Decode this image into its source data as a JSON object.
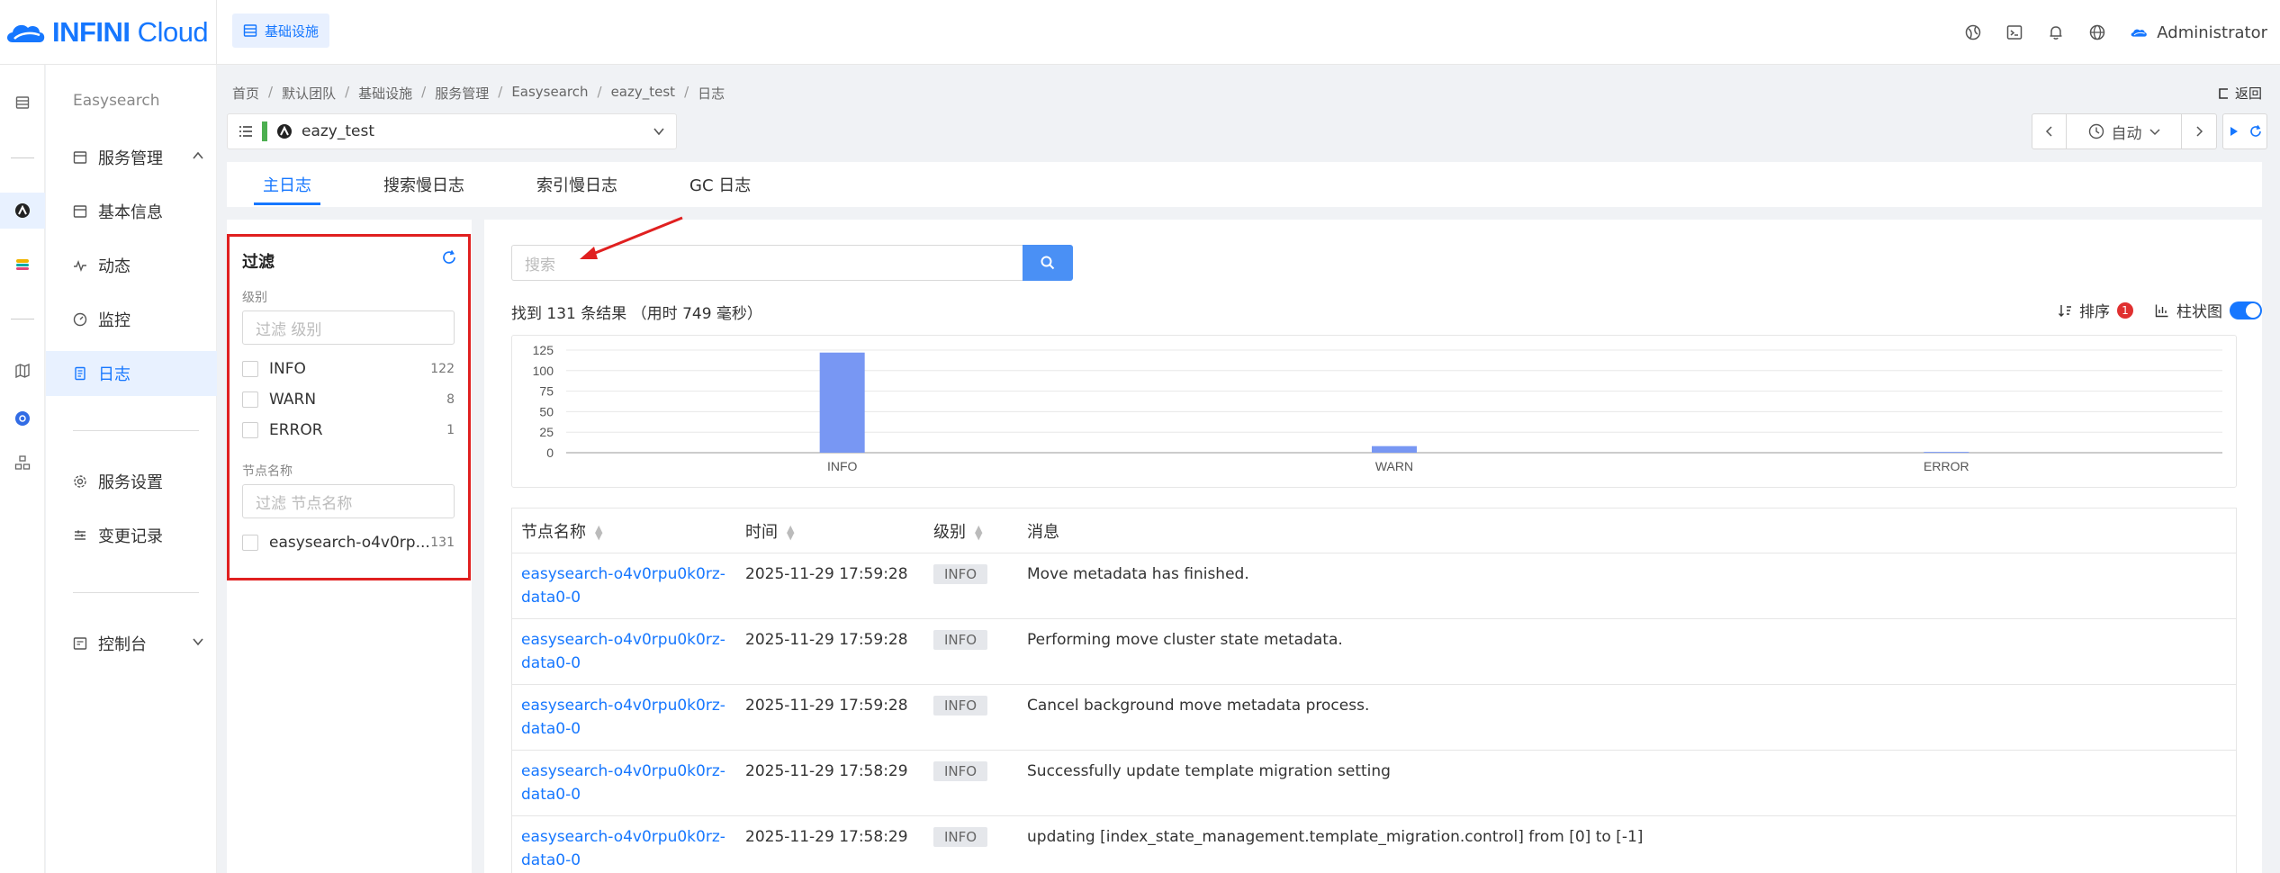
{
  "brand": {
    "logo_bold": "INFINI",
    "logo_light": " Cloud"
  },
  "top_chip": "基础设施",
  "user": "Administrator",
  "side_menu": {
    "section_title": "Easysearch",
    "items": [
      {
        "label": "服务管理"
      },
      {
        "label": "基本信息"
      },
      {
        "label": "动态"
      },
      {
        "label": "监控"
      },
      {
        "label": "日志"
      },
      {
        "label": "服务设置"
      },
      {
        "label": "变更记录"
      },
      {
        "label": "控制台"
      }
    ]
  },
  "breadcrumb": [
    "首页",
    "默认团队",
    "基础设施",
    "服务管理",
    "Easysearch",
    "eazy_test",
    "日志"
  ],
  "back_label": "返回",
  "cluster": "eazy_test",
  "time_mode": "自动",
  "tabs": [
    "主日志",
    "搜索慢日志",
    "索引慢日志",
    "GC 日志"
  ],
  "filter": {
    "title": "过滤",
    "level_label": "级别",
    "level_placeholder": "过滤 级别",
    "levels": [
      {
        "name": "INFO",
        "count": "122"
      },
      {
        "name": "WARN",
        "count": "8"
      },
      {
        "name": "ERROR",
        "count": "1"
      }
    ],
    "node_label": "节点名称",
    "node_placeholder": "过滤 节点名称",
    "nodes": [
      {
        "name": "easysearch-o4v0rp...",
        "count": "131"
      }
    ]
  },
  "search": {
    "placeholder": "搜索"
  },
  "results_text": "找到 131 条结果 （用时 749 毫秒）",
  "sort_label": "排序",
  "sort_badge": "1",
  "histogram_label": "柱状图",
  "chart_data": {
    "type": "bar",
    "categories": [
      "INFO",
      "WARN",
      "ERROR"
    ],
    "values": [
      122,
      8,
      1
    ],
    "ylim": [
      0,
      125
    ],
    "yticks": [
      "125",
      "100",
      "75",
      "50",
      "25",
      "0"
    ],
    "grid": true,
    "color": "#7897f3"
  },
  "table": {
    "headers": [
      "节点名称",
      "时间",
      "级别",
      "消息"
    ],
    "rows": [
      {
        "node1": "easysearch-o4v0rpu0k0rz-",
        "node2": "data0-0",
        "time": "2025-11-29 17:59:28",
        "level": "INFO",
        "message": "Move metadata has finished."
      },
      {
        "node1": "easysearch-o4v0rpu0k0rz-",
        "node2": "data0-0",
        "time": "2025-11-29 17:59:28",
        "level": "INFO",
        "message": "Performing move cluster state metadata."
      },
      {
        "node1": "easysearch-o4v0rpu0k0rz-",
        "node2": "data0-0",
        "time": "2025-11-29 17:59:28",
        "level": "INFO",
        "message": "Cancel background move metadata process."
      },
      {
        "node1": "easysearch-o4v0rpu0k0rz-",
        "node2": "data0-0",
        "time": "2025-11-29 17:58:29",
        "level": "INFO",
        "message": "Successfully update template migration setting"
      },
      {
        "node1": "easysearch-o4v0rpu0k0rz-",
        "node2": "data0-0",
        "time": "2025-11-29 17:58:29",
        "level": "INFO",
        "message": "updating [index_state_management.template_migration.control] from [0] to [-1]"
      }
    ]
  }
}
